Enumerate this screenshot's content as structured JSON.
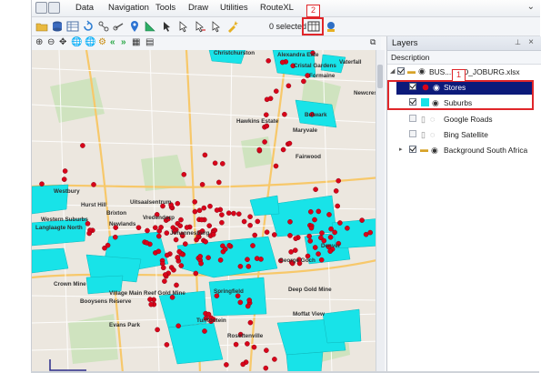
{
  "menubar": {
    "items": [
      "Data",
      "Navigation",
      "Tools",
      "Draw",
      "Utilities",
      "RouteXL"
    ]
  },
  "toolbar": {
    "selected_text": "0 selected",
    "badge_2": "2"
  },
  "layers_panel": {
    "title": "Layers",
    "pin_icon": "pin-icon",
    "close_icon": "close-icon",
    "description_header": "Description",
    "root_layer": "BUS...EMO_JOBURG.xlsx",
    "badge_1": "1",
    "layers": [
      {
        "name": "Stores",
        "checked": true,
        "selected": true,
        "icon": "red-dot-icon"
      },
      {
        "name": "Suburbs",
        "checked": true,
        "selected": false,
        "icon": "cyan-polygon-icon"
      },
      {
        "name": "Google Roads",
        "checked": false,
        "selected": false,
        "icon": "roads-icon"
      },
      {
        "name": "Bing Satellite",
        "checked": false,
        "selected": false,
        "icon": "satellite-icon"
      },
      {
        "name": "Background South Africa",
        "checked": true,
        "selected": false,
        "icon": "folder-icon"
      }
    ]
  },
  "map": {
    "labels": [
      "Christchurston",
      "Alexandra Exte",
      "Cristal Gardens",
      "Formaine",
      "Vaterfall",
      "Newcrest",
      "Hawkins Estate",
      "Bulwark",
      "Maryvale",
      "Fairwood",
      "Westbury",
      "Hurst Hill",
      "Brixton",
      "Vredendorp",
      "Uitsaalsentrum",
      "Newlands",
      "Western Suburbs",
      "Langlaagte North",
      "Johannesburg",
      "Denver",
      "Crown Mine",
      "Village Main Reef Gold Mine",
      "Booysens Reserve",
      "George Goch",
      "Springfield",
      "Deep Gold Mine",
      "Evans Park",
      "Turffontein",
      "Moffat View",
      "Rosettenville"
    ],
    "store_color": "#d9041a",
    "suburb_color": "#18e3e8"
  }
}
